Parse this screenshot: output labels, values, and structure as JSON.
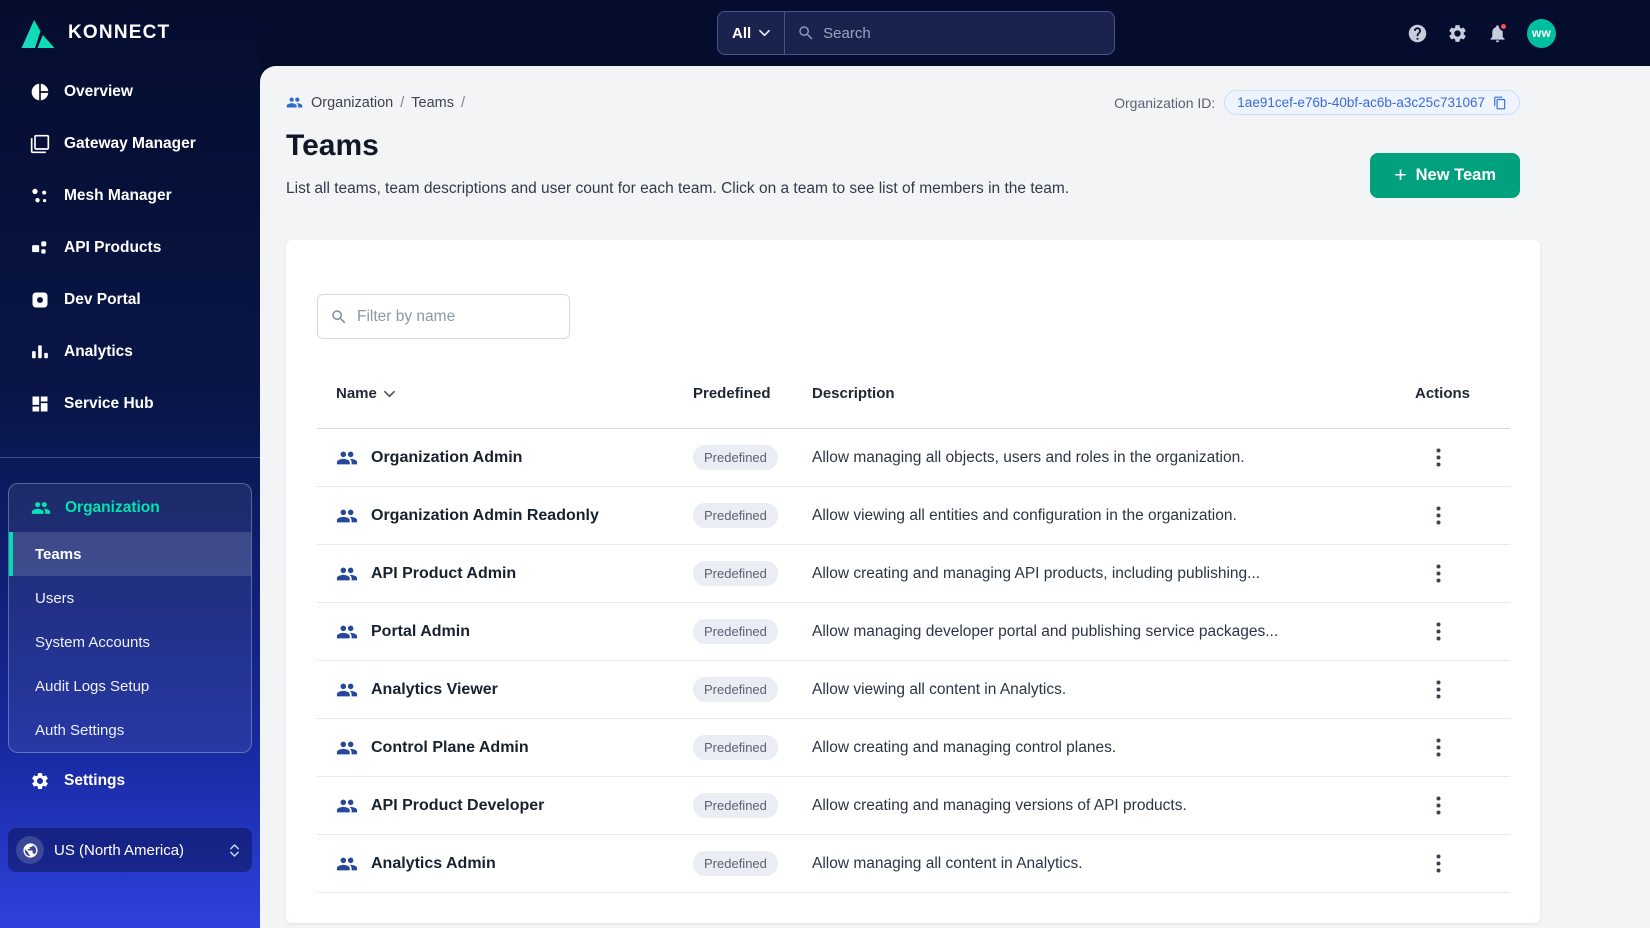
{
  "colors": {
    "accent_teal": "#00a17c",
    "accent_teal_bright": "#00dfb4",
    "sidebar_top": "#050d2e",
    "sidebar_bottom": "#2e41dd",
    "org_id_blue": "#3b6cd4",
    "row_icon_blue": "#26489c",
    "badge_bg": "#ebedf4",
    "notification_red": "#fa5252",
    "avatar_bg": "#00bfa0"
  },
  "brand": {
    "wordmark": "KONNECT"
  },
  "topbar": {
    "scope": "All",
    "search_placeholder": "Search",
    "avatar": "ww"
  },
  "sidebar": {
    "items": [
      {
        "label": "Overview"
      },
      {
        "label": "Gateway Manager"
      },
      {
        "label": "Mesh Manager"
      },
      {
        "label": "API Products"
      },
      {
        "label": "Dev Portal"
      },
      {
        "label": "Analytics"
      },
      {
        "label": "Service Hub"
      }
    ],
    "organization": {
      "label": "Organization",
      "subitems": [
        {
          "label": "Teams",
          "active": true
        },
        {
          "label": "Users",
          "active": false
        },
        {
          "label": "System Accounts",
          "active": false
        },
        {
          "label": "Audit Logs Setup",
          "active": false
        },
        {
          "label": "Auth Settings",
          "active": false
        }
      ]
    },
    "settings": "Settings",
    "region": "US (North America)"
  },
  "header": {
    "breadcrumb": {
      "items": [
        "Organization",
        "Teams"
      ],
      "separator": "/"
    },
    "org_id_label": "Organization ID:",
    "org_id_value": "1ae91cef-e76b-40bf-ac6b-a3c25c731067",
    "title": "Teams",
    "description": "List all teams, team descriptions and user count for each team. Click on a team to see list of members in the team.",
    "new_team_plus": "+",
    "new_team": "New Team"
  },
  "table": {
    "filter_placeholder": "Filter by name",
    "columns": {
      "name": "Name",
      "predefined": "Predefined",
      "description": "Description",
      "actions": "Actions"
    },
    "rows": [
      {
        "name": "Organization Admin",
        "predefined": "Predefined",
        "description": "Allow managing all objects, users and roles in the organization."
      },
      {
        "name": "Organization Admin Readonly",
        "predefined": "Predefined",
        "description": "Allow viewing all entities and configuration in the organization."
      },
      {
        "name": "API Product Admin",
        "predefined": "Predefined",
        "description": "Allow creating and managing API products, including publishing..."
      },
      {
        "name": "Portal Admin",
        "predefined": "Predefined",
        "description": "Allow managing developer portal and publishing service packages..."
      },
      {
        "name": "Analytics Viewer",
        "predefined": "Predefined",
        "description": "Allow viewing all content in Analytics."
      },
      {
        "name": "Control Plane Admin",
        "predefined": "Predefined",
        "description": "Allow creating and managing control planes."
      },
      {
        "name": "API Product Developer",
        "predefined": "Predefined",
        "description": "Allow creating and managing versions of API products."
      },
      {
        "name": "Analytics Admin",
        "predefined": "Predefined",
        "description": "Allow managing all content in Analytics."
      }
    ]
  }
}
